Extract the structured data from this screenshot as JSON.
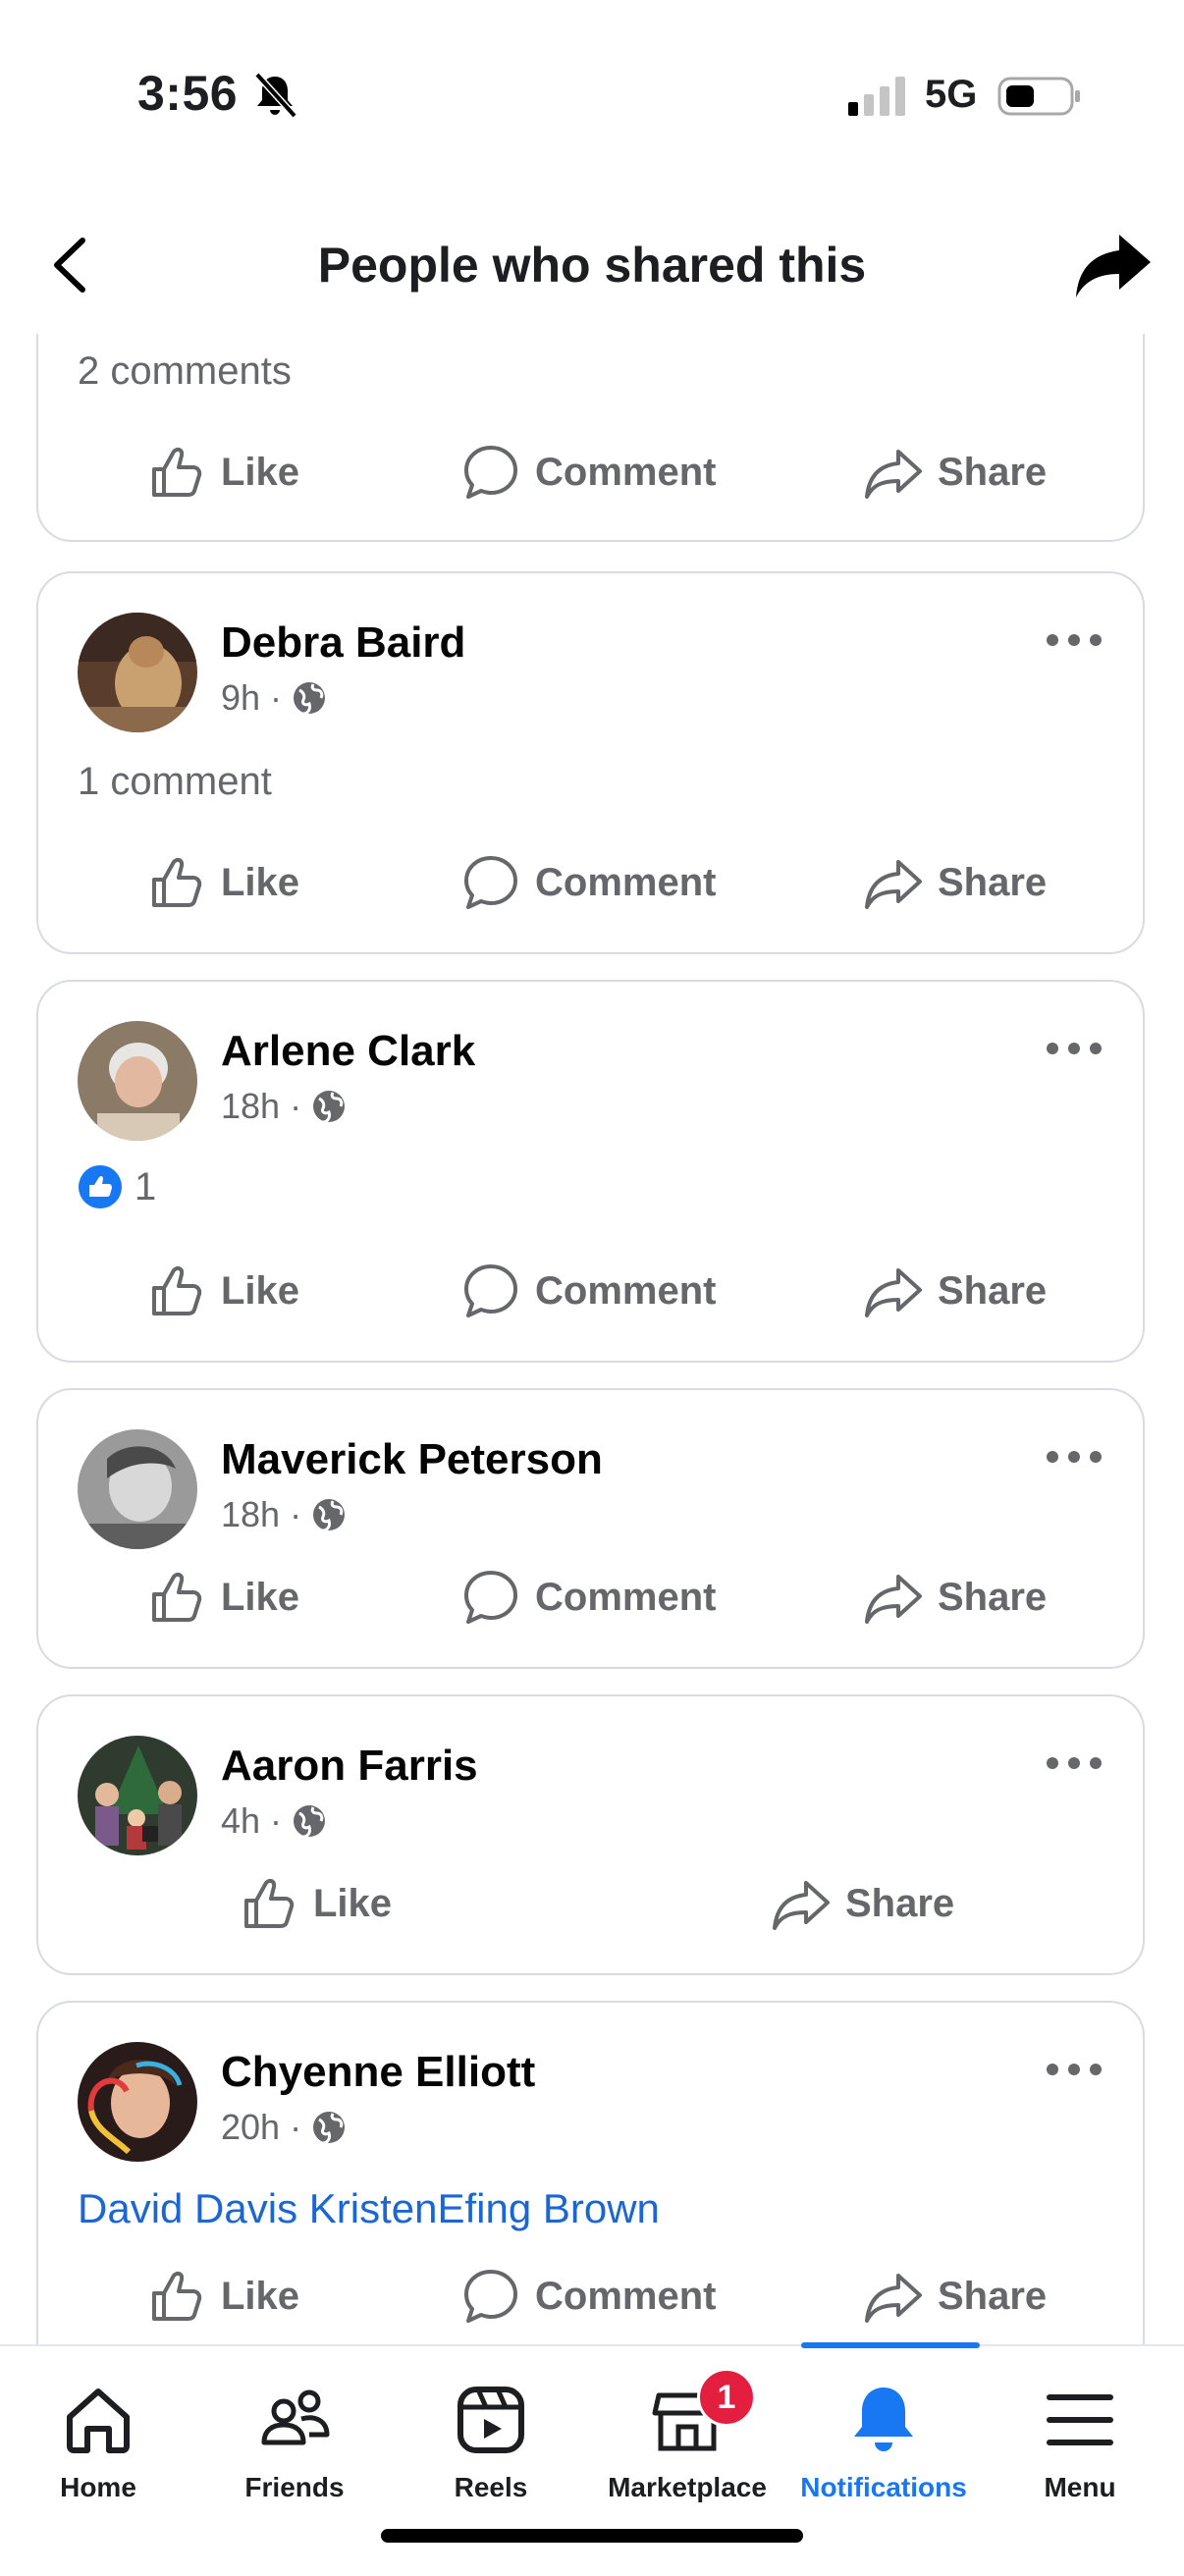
{
  "status_bar": {
    "time": "3:56",
    "network": "5G"
  },
  "header": {
    "title": "People who shared this"
  },
  "top_partial_card": {
    "comments": "2 comments",
    "actions": {
      "like": "Like",
      "comment": "Comment",
      "share": "Share"
    }
  },
  "posts": [
    {
      "name": "Debra Baird",
      "time": "9h",
      "separator": "·",
      "extra": "1 comment",
      "actions": {
        "like": "Like",
        "comment": "Comment",
        "share": "Share"
      }
    },
    {
      "name": "Arlene Clark",
      "time": "18h",
      "separator": "·",
      "reaction_count": "1",
      "actions": {
        "like": "Like",
        "comment": "Comment",
        "share": "Share"
      }
    },
    {
      "name": "Maverick Peterson",
      "time": "18h",
      "separator": "·",
      "actions": {
        "like": "Like",
        "comment": "Comment",
        "share": "Share"
      }
    },
    {
      "name": "Aaron Farris",
      "time": "4h",
      "separator": "·",
      "actions": {
        "like": "Like",
        "share": "Share"
      }
    },
    {
      "name": "Chyenne Elliott",
      "time": "20h",
      "separator": "·",
      "tags": "David Davis KristenEfing Brown",
      "actions": {
        "like": "Like",
        "comment": "Comment",
        "share": "Share"
      }
    }
  ],
  "bottom_nav": {
    "items": [
      {
        "label": "Home",
        "icon": "home-icon"
      },
      {
        "label": "Friends",
        "icon": "friends-icon"
      },
      {
        "label": "Reels",
        "icon": "reels-icon"
      },
      {
        "label": "Marketplace",
        "icon": "marketplace-icon",
        "badge": "1"
      },
      {
        "label": "Notifications",
        "icon": "bell-icon",
        "active": true
      },
      {
        "label": "Menu",
        "icon": "menu-icon"
      }
    ]
  },
  "colors": {
    "accent": "#1877f2",
    "link": "#1a66d6",
    "badge": "#e41e3f",
    "secondary_text": "#65676b"
  }
}
